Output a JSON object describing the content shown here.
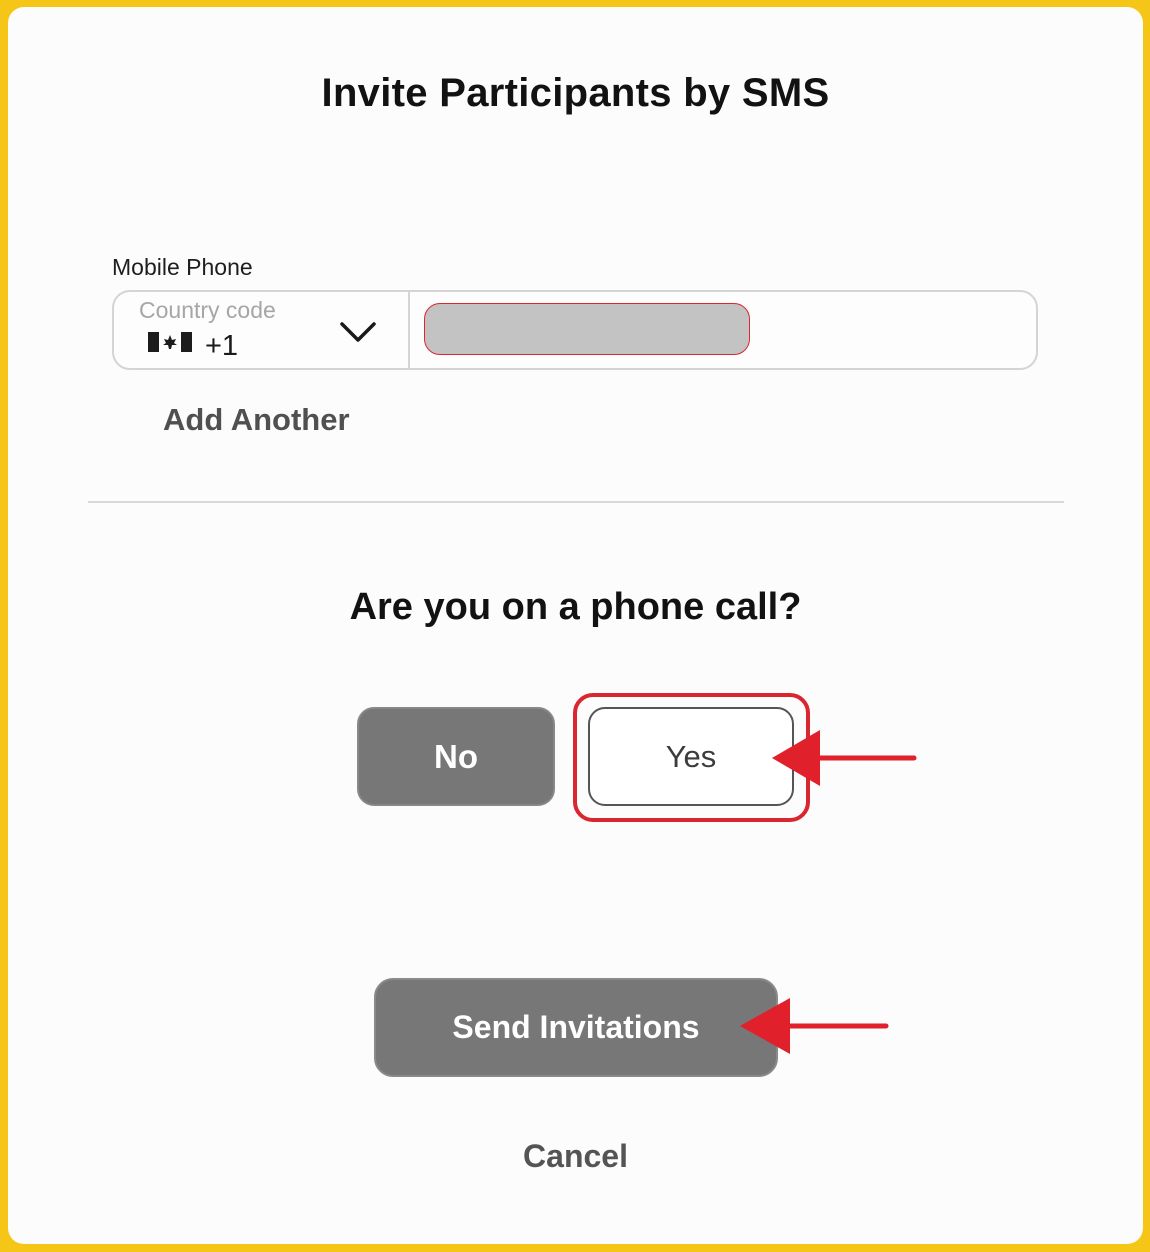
{
  "dialog": {
    "title": "Invite Participants by SMS"
  },
  "phone": {
    "label": "Mobile Phone",
    "country_placeholder": "Country code",
    "country_value": "+1",
    "country_flag_icon": "canada-flag-icon",
    "dropdown_icon": "chevron-down-icon",
    "number_value": "[redacted]"
  },
  "add_another_label": "Add Another",
  "phone_call": {
    "question": "Are you on a phone call?",
    "no_label": "No",
    "yes_label": "Yes"
  },
  "actions": {
    "send_label": "Send Invitations",
    "cancel_label": "Cancel"
  },
  "annotations": {
    "highlight_color": "#d9262f",
    "arrow_color": "#e0202a"
  },
  "colors": {
    "frame": "#f5c518",
    "button_gray": "#777777"
  }
}
